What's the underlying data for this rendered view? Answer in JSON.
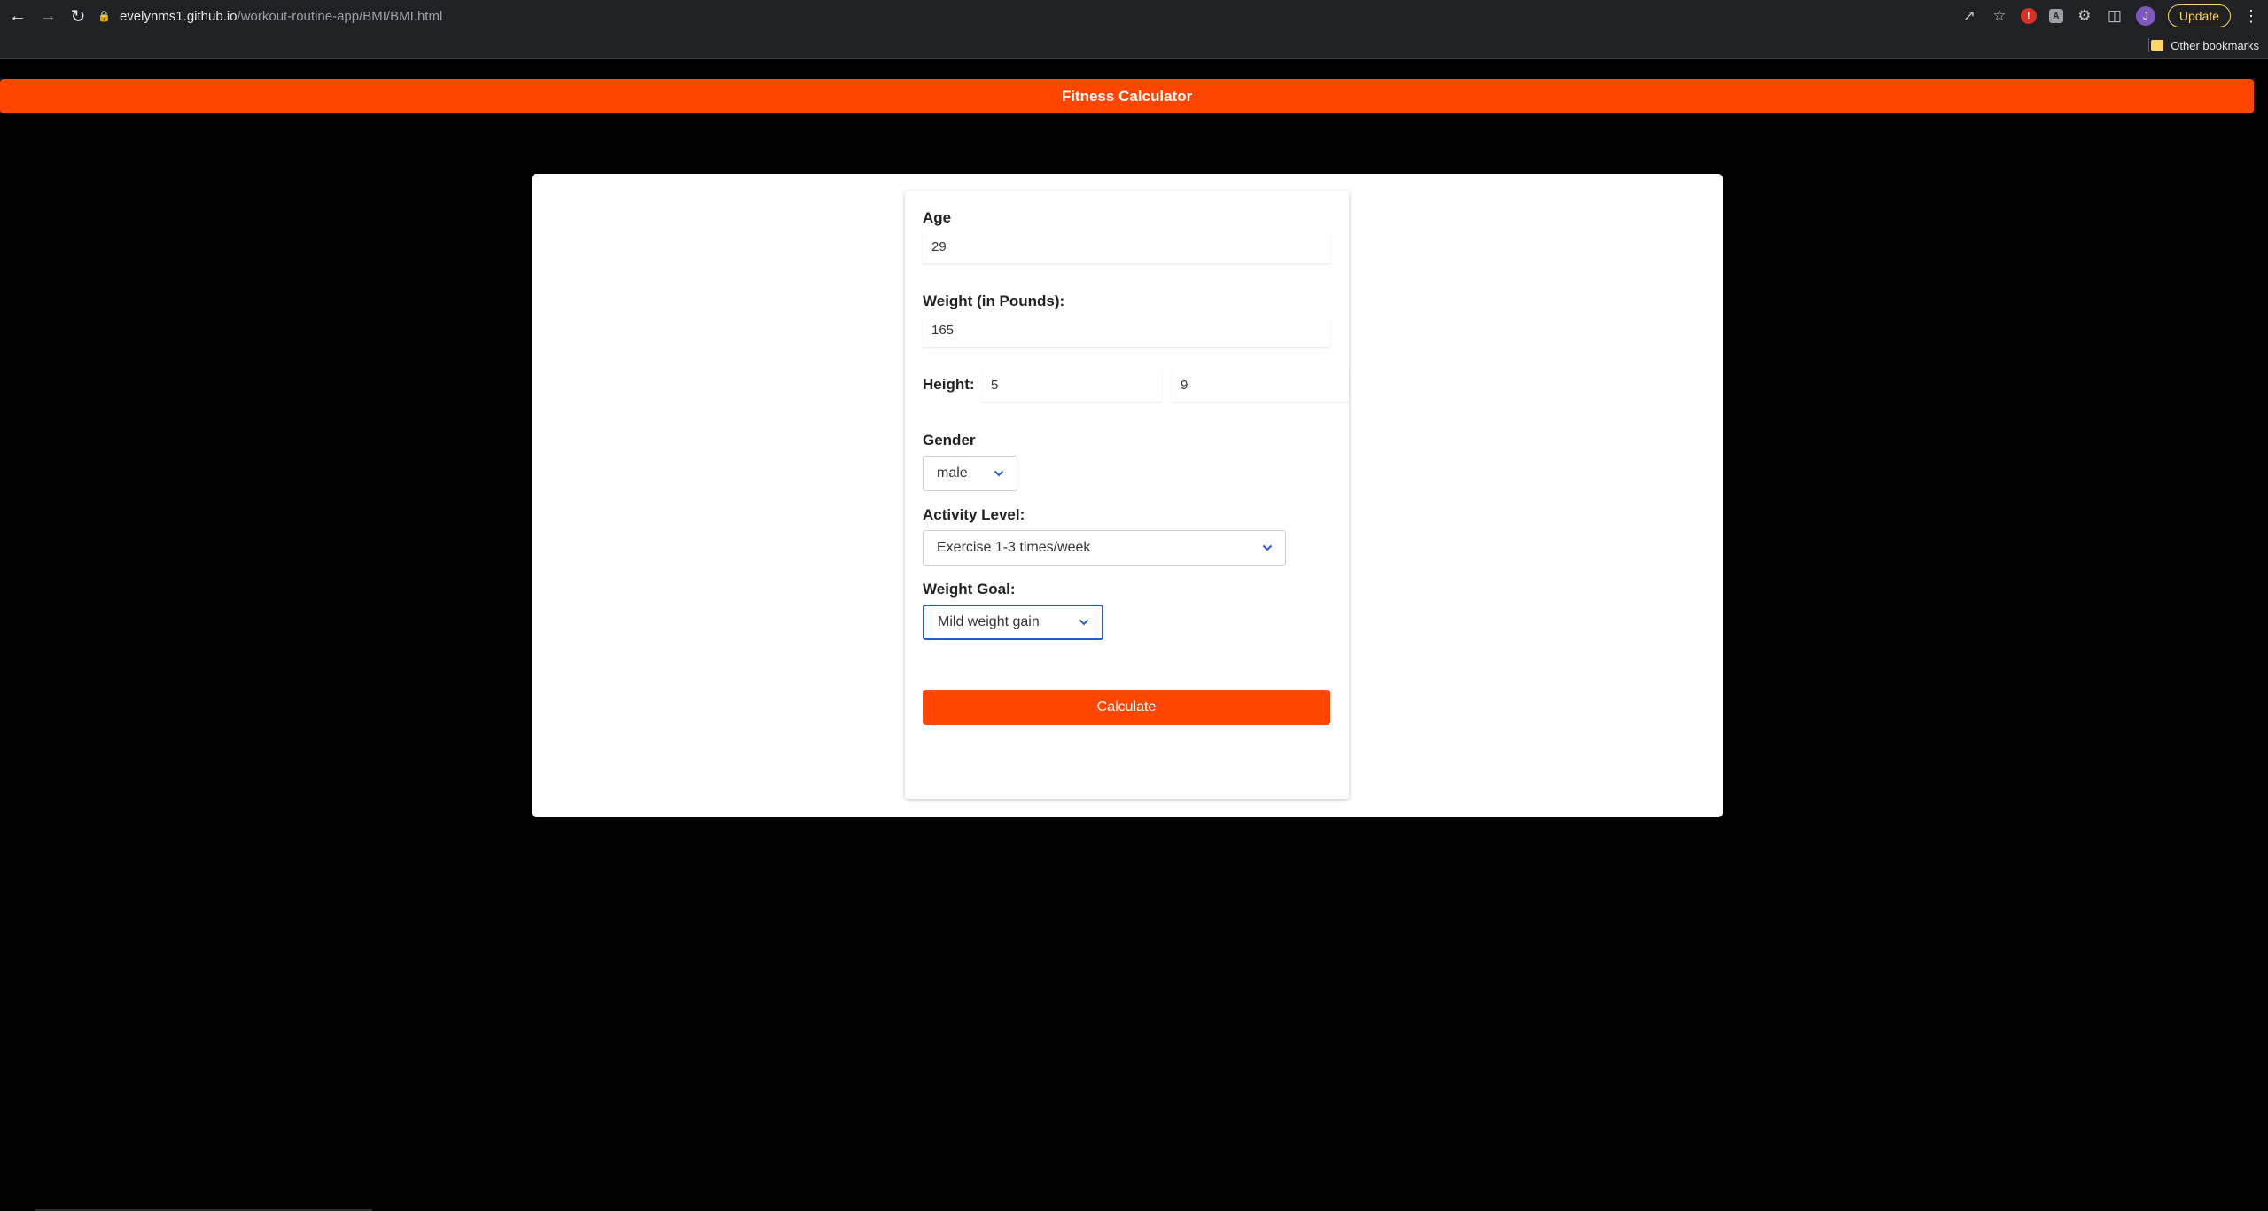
{
  "browser": {
    "url_host": "evelynms1.github.io",
    "url_path": "/workout-routine-app/BMI/BMI.html",
    "update_label": "Update",
    "avatar_letter": "J",
    "other_bookmarks": "Other bookmarks"
  },
  "header": {
    "title": "Fitness Calculator"
  },
  "form": {
    "age_label": "Age",
    "age_value": "29",
    "weight_label": "Weight (in Pounds):",
    "weight_value": "165",
    "height_label": "Height:",
    "height_feet": "5",
    "height_inches": "9",
    "gender_label": "Gender",
    "gender_value": "male",
    "activity_label": "Activity Level:",
    "activity_value": "Exercise 1-3 times/week",
    "goal_label": "Weight Goal:",
    "goal_value": "Mild weight gain",
    "calculate_label": "Calculate"
  },
  "colors": {
    "accent": "#ff4500",
    "focus": "#2f5bc4"
  }
}
